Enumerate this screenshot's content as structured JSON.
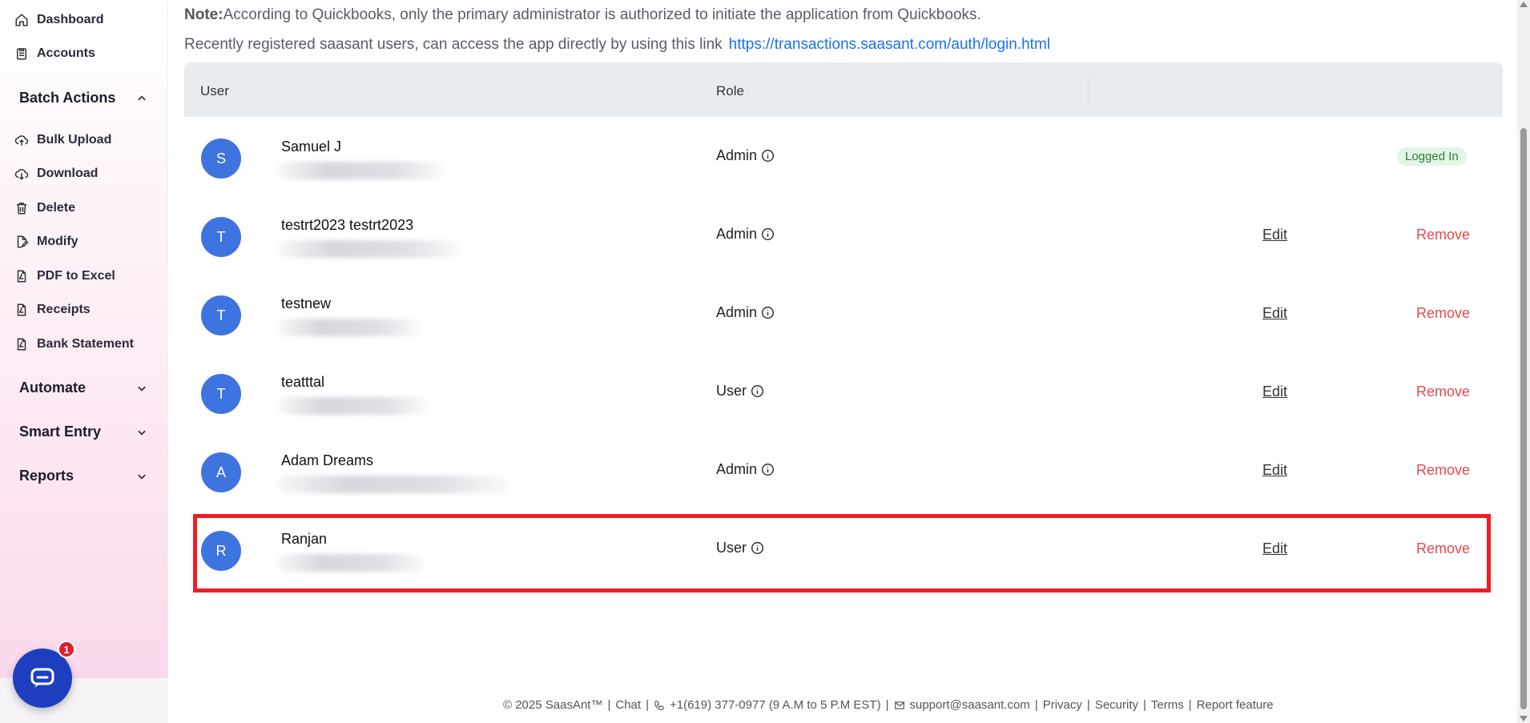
{
  "sidebar": {
    "items_top": [
      {
        "label": "Dashboard",
        "icon": "home-icon"
      },
      {
        "label": "Accounts",
        "icon": "clipboard-icon"
      }
    ],
    "batch_actions": {
      "label": "Batch Actions",
      "items": [
        {
          "label": "Bulk Upload",
          "icon": "cloud-upload-icon"
        },
        {
          "label": "Download",
          "icon": "cloud-download-icon"
        },
        {
          "label": "Delete",
          "icon": "trash-icon"
        },
        {
          "label": "Modify",
          "icon": "edit-document-icon"
        },
        {
          "label": "PDF to Excel",
          "icon": "pdf-icon"
        },
        {
          "label": "Receipts",
          "icon": "pdf-icon"
        },
        {
          "label": "Bank Statement",
          "icon": "pdf-icon"
        }
      ]
    },
    "sections": [
      {
        "label": "Automate"
      },
      {
        "label": "Smart Entry"
      },
      {
        "label": "Reports"
      }
    ]
  },
  "chat": {
    "badge": "1"
  },
  "note": {
    "prefix": "Note:",
    "text": "According to Quickbooks, only the primary administrator is authorized to initiate the application from Quickbooks."
  },
  "recent": {
    "text": "Recently registered saasant users, can access the app directly by using this link",
    "link": "https://transactions.saasant.com/auth/login.html"
  },
  "table": {
    "headers": {
      "user": "User",
      "role": "Role"
    },
    "rows": [
      {
        "initial": "S",
        "name": "Samuel J",
        "role": "Admin",
        "status": "Logged In"
      },
      {
        "initial": "T",
        "name": "testrt2023 testrt2023",
        "role": "Admin",
        "edit": "Edit",
        "remove": "Remove"
      },
      {
        "initial": "T",
        "name": "testnew",
        "role": "Admin",
        "edit": "Edit",
        "remove": "Remove"
      },
      {
        "initial": "T",
        "name": "teatttal",
        "role": "User",
        "edit": "Edit",
        "remove": "Remove"
      },
      {
        "initial": "A",
        "name": "Adam Dreams",
        "role": "Admin",
        "edit": "Edit",
        "remove": "Remove"
      },
      {
        "initial": "R",
        "name": "Ranjan",
        "role": "User",
        "edit": "Edit",
        "remove": "Remove"
      }
    ]
  },
  "footer": {
    "copyright": "© 2025 SaasAnt™",
    "chat": "Chat",
    "phone": "+1(619) 377-0977 (9 A.M to 5 P.M EST)",
    "email": "support@saasant.com",
    "privacy": "Privacy",
    "security": "Security",
    "terms": "Terms",
    "report": "Report feature"
  },
  "colors": {
    "avatar": "#3e74e0",
    "remove": "#e5484d",
    "link": "#1a73e8",
    "highlight": "#ee1c25",
    "logged_in_bg": "#e3f5e6"
  }
}
